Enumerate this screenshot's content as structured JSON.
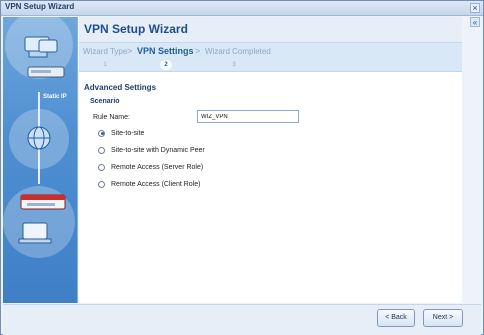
{
  "window": {
    "title": "VPN Setup Wizard",
    "close_glyph": "×",
    "collapse_glyph": "«"
  },
  "left_panel": {
    "static_ip_label": "Static IP"
  },
  "header": {
    "title": "VPN Setup Wizard"
  },
  "steps": [
    {
      "label": "Wizard Type",
      "number": "1"
    },
    {
      "label": "VPN Settings",
      "number": "2"
    },
    {
      "label": "Wizard Completed",
      "number": "3"
    }
  ],
  "step_separator": ">",
  "advanced": {
    "title": "Advanced Settings",
    "scenario_title": "Scenario",
    "rule_label": "Rule Name:",
    "rule_value": "WIZ_VPN"
  },
  "options": [
    {
      "label": "Site-to-site"
    },
    {
      "label": "Site-to-site with Dynamic Peer"
    },
    {
      "label": "Remote Access (Server Role)"
    },
    {
      "label": "Remote Access (Client Role)"
    }
  ],
  "buttons": {
    "back": "< Back",
    "next": "Next >"
  }
}
